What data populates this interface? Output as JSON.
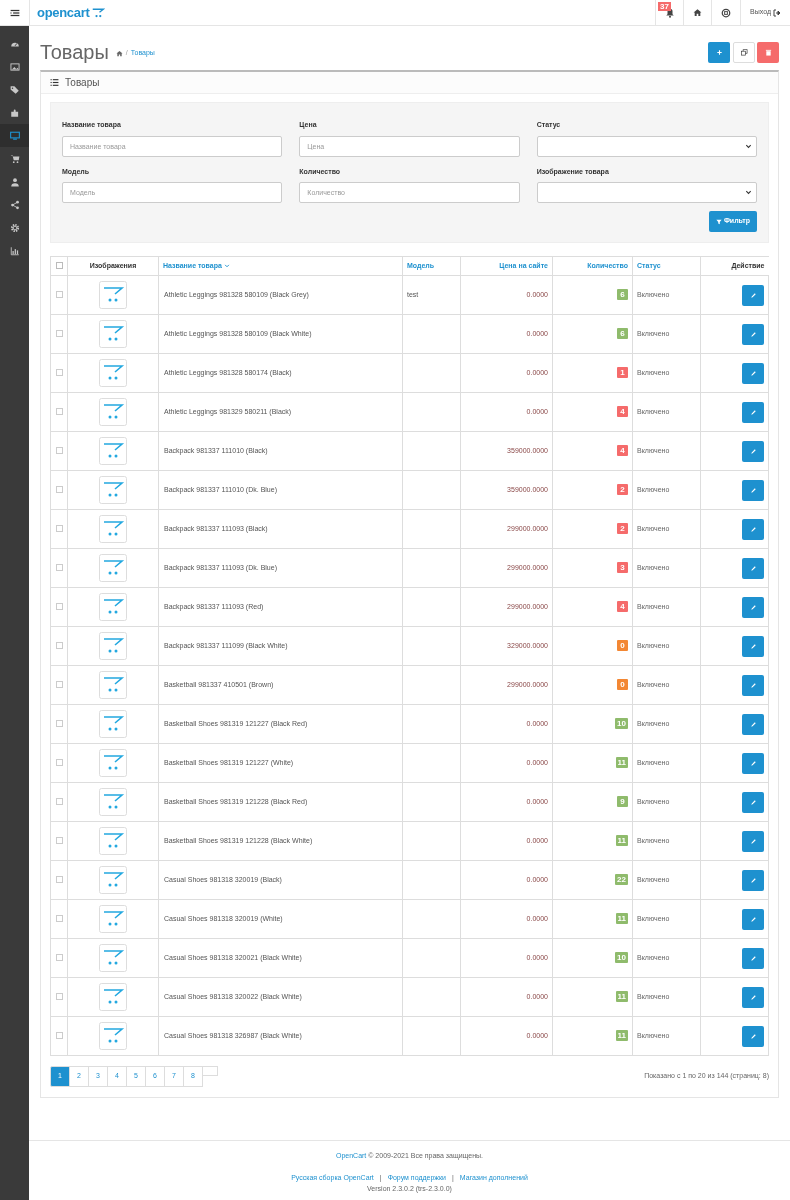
{
  "topbar": {
    "logo": "opencart",
    "notification_count": "37",
    "logout": "Выход"
  },
  "sidebar": {
    "items": [
      {
        "kind": "dashboard",
        "selected": false
      },
      {
        "kind": "image",
        "selected": false
      },
      {
        "kind": "tags",
        "selected": false
      },
      {
        "kind": "puzzle",
        "selected": false
      },
      {
        "kind": "desktop",
        "selected": true
      },
      {
        "kind": "cart",
        "selected": false
      },
      {
        "kind": "user",
        "selected": false
      },
      {
        "kind": "share",
        "selected": false
      },
      {
        "kind": "gear",
        "selected": false
      },
      {
        "kind": "chart",
        "selected": false
      }
    ]
  },
  "page": {
    "title": "Товары",
    "breadcrumb_separator": "/",
    "breadcrumb": "Товары"
  },
  "panel": {
    "title": "Товары"
  },
  "filters": [
    {
      "kind": "text",
      "label": "Название товара",
      "placeholder": "Название товара"
    },
    {
      "kind": "text",
      "label": "Цена",
      "placeholder": "Цена"
    },
    {
      "kind": "select",
      "label": "Статус"
    },
    {
      "kind": "text",
      "label": "Модель",
      "placeholder": "Модель"
    },
    {
      "kind": "text",
      "label": "Количество",
      "placeholder": "Количество"
    },
    {
      "kind": "select",
      "label": "Изображение товара"
    }
  ],
  "filter_button": "Фильтр",
  "table": {
    "select_all_checked": false,
    "columns": [
      {
        "label": "Изображения",
        "sortable": false,
        "sorted": false
      },
      {
        "label": "Название товара",
        "sortable": true,
        "sorted": true
      },
      {
        "label": "Модель",
        "sortable": true,
        "sorted": false
      },
      {
        "label": "Цена на сайте",
        "sortable": true,
        "sorted": false
      },
      {
        "label": "Количество",
        "sortable": true,
        "sorted": false
      },
      {
        "label": "Статус",
        "sortable": true,
        "sorted": false
      },
      {
        "label": "Действие",
        "sortable": false,
        "sorted": false
      }
    ],
    "rows": [
      {
        "checked": false,
        "name": "Athletic Leggings 981328 580109 (Black Grey)",
        "model": "test",
        "price": "0.0000",
        "quantity": "6",
        "color": "#8fbb6c",
        "status": "Включено"
      },
      {
        "checked": false,
        "name": "Athletic Leggings 981328 580109 (Black White)",
        "price": "0.0000",
        "quantity": "6",
        "color": "#8fbb6c",
        "status": "Включено"
      },
      {
        "checked": false,
        "name": "Athletic Leggings 981328 580174 (Black)",
        "price": "0.0000",
        "quantity": "1",
        "color": "#f56b6b",
        "status": "Включено"
      },
      {
        "checked": false,
        "name": "Athletic Leggings 981329 580211 (Black)",
        "price": "0.0000",
        "quantity": "4",
        "color": "#f56b6b",
        "status": "Включено"
      },
      {
        "checked": false,
        "name": "Backpack 981337 111010 (Black)",
        "price": "359000.0000",
        "quantity": "4",
        "color": "#f56b6b",
        "status": "Включено"
      },
      {
        "checked": false,
        "name": "Backpack 981337 111010 (Dk. Blue)",
        "price": "359000.0000",
        "quantity": "2",
        "color": "#f56b6b",
        "status": "Включено"
      },
      {
        "checked": false,
        "name": "Backpack 981337 111093 (Black)",
        "price": "299000.0000",
        "quantity": "2",
        "color": "#f56b6b",
        "status": "Включено"
      },
      {
        "checked": false,
        "name": "Backpack 981337 111093 (Dk. Blue)",
        "price": "299000.0000",
        "quantity": "3",
        "color": "#f56b6b",
        "status": "Включено"
      },
      {
        "checked": false,
        "name": "Backpack 981337 111093 (Red)",
        "price": "299000.0000",
        "quantity": "4",
        "color": "#f56b6b",
        "status": "Включено"
      },
      {
        "checked": false,
        "name": "Backpack 981337 111099 (Black White)",
        "price": "329000.0000",
        "quantity": "0",
        "color": "#f38733",
        "status": "Включено"
      },
      {
        "checked": false,
        "name": "Basketball 981337 410501 (Brown)",
        "price": "299000.0000",
        "quantity": "0",
        "color": "#f38733",
        "status": "Включено"
      },
      {
        "checked": false,
        "name": "Basketball Shoes 981319 121227 (Black Red)",
        "price": "0.0000",
        "quantity": "10",
        "color": "#8fbb6c",
        "status": "Включено"
      },
      {
        "checked": false,
        "name": "Basketball Shoes 981319 121227 (White)",
        "price": "0.0000",
        "quantity": "11",
        "color": "#8fbb6c",
        "status": "Включено"
      },
      {
        "checked": false,
        "name": "Basketball Shoes 981319 121228 (Black Red)",
        "price": "0.0000",
        "quantity": "9",
        "color": "#8fbb6c",
        "status": "Включено"
      },
      {
        "checked": false,
        "name": "Basketball Shoes 981319 121228 (Black White)",
        "price": "0.0000",
        "quantity": "11",
        "color": "#8fbb6c",
        "status": "Включено"
      },
      {
        "checked": false,
        "name": "Casual Shoes 981318 320019 (Black)",
        "price": "0.0000",
        "quantity": "22",
        "color": "#8fbb6c",
        "status": "Включено"
      },
      {
        "checked": false,
        "name": "Casual Shoes 981318 320019 (White)",
        "price": "0.0000",
        "quantity": "11",
        "color": "#8fbb6c",
        "status": "Включено"
      },
      {
        "checked": false,
        "name": "Casual Shoes 981318 320021 (Black White)",
        "price": "0.0000",
        "quantity": "10",
        "color": "#8fbb6c",
        "status": "Включено"
      },
      {
        "checked": false,
        "name": "Casual Shoes 981318 320022 (Black White)",
        "price": "0.0000",
        "quantity": "11",
        "color": "#8fbb6c",
        "status": "Включено"
      },
      {
        "checked": false,
        "name": "Casual Shoes 981318 326987 (Black White)",
        "price": "0.0000",
        "quantity": "11",
        "color": "#8fbb6c",
        "status": "Включено"
      }
    ]
  },
  "pagination": {
    "pages": [
      {
        "label": "1",
        "selected": true
      },
      {
        "label": "2",
        "selected": false
      },
      {
        "label": "3",
        "selected": false
      },
      {
        "label": "4",
        "selected": false
      },
      {
        "label": "5",
        "selected": false
      },
      {
        "label": "6",
        "selected": false
      },
      {
        "label": "7",
        "selected": false
      },
      {
        "label": "8",
        "selected": false
      }
    ],
    "summary": "Показано с 1 по 20 из 144 (страниц: 8)"
  },
  "footer": {
    "brand_link": "OpenCart",
    "copyright": "© 2009-2021 Все права защищены.",
    "links": [
      "Русская сборка OpenCart",
      "Форум поддержки",
      "Магазин дополнений"
    ],
    "separators": [
      "|",
      "|"
    ],
    "version": "Version 2.3.0.2 (trs-2.3.0.0)"
  }
}
